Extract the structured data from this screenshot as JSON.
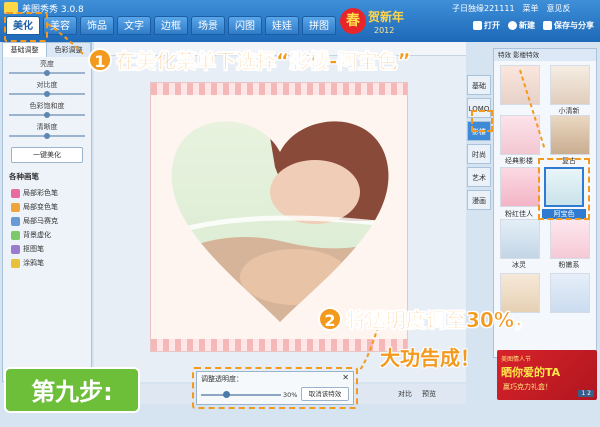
{
  "app": {
    "title": "美图秀秀 3.0.8",
    "user": "子日独缘221111",
    "menu_btn1": "菜单",
    "menu_btn2": "意见反"
  },
  "menu": {
    "tabs": [
      "美化",
      "美容",
      "饰品",
      "文字",
      "边框",
      "场景",
      "闪图",
      "娃娃",
      "拼图"
    ]
  },
  "top_actions": {
    "open": "打开",
    "new": "新建",
    "save_share": "保存与分享"
  },
  "spring_banner": {
    "badge": "春",
    "text": "贺新年",
    "year": "2012"
  },
  "left_panel": {
    "tabs": [
      "基础调整",
      "色彩调整"
    ],
    "sliders": [
      {
        "label": "亮度",
        "value": 0.5
      },
      {
        "label": "对比度",
        "value": 0.5
      },
      {
        "label": "色彩饱和度",
        "value": 0.5
      },
      {
        "label": "清晰度",
        "value": 0.5
      }
    ],
    "one_key": "一键美化",
    "brush_title": "各种画笔",
    "brushes": [
      "局部彩色笔",
      "局部变色笔",
      "局部马赛克",
      "背景虚化",
      "抠图笔",
      "涂鸦笔"
    ]
  },
  "categories": [
    "基础",
    "LOMO",
    "影楼",
    "时尚",
    "艺术",
    "漫画"
  ],
  "effects": {
    "header": "特效 影楼特效",
    "items": [
      "小清新",
      "复古",
      "经典影楼",
      "粉红佳人",
      "阿宝色",
      "冰灵",
      "粉嫩系"
    ],
    "selected": "阿宝色"
  },
  "opacity_dialog": {
    "title": "调整透明度：",
    "percent": "30%",
    "value": 0.3,
    "cancel": "取消该特效",
    "close": "✕"
  },
  "bottom": {
    "compare": "对比",
    "preview": "预览"
  },
  "ad": {
    "line1": "美图情人节",
    "line2": "晒你爱的TA",
    "line3": "赢巧克力礼盒！",
    "page": "1 2"
  },
  "annotations": {
    "c1_num": "1",
    "c1_text": "在美化菜单下选择“影楼-阿宝色”",
    "c2_num": "2",
    "c2_text": "将透明度调至30%，",
    "c2_text2": "大功告成！",
    "step": "第九步:"
  },
  "colors": {
    "accent": "#f39a1e",
    "title_blue": "#1e69b8",
    "step_green": "#6dbf3a"
  }
}
